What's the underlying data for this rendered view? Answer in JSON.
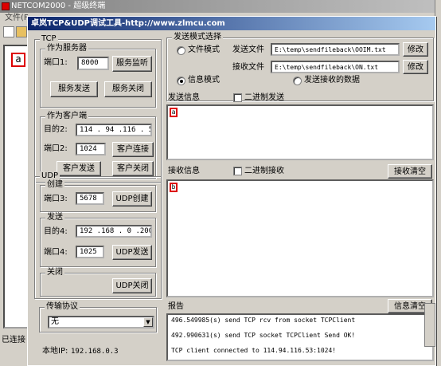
{
  "background_window": {
    "title": "NETCOM2000 - 超级终端",
    "menu_file": "文件(F",
    "edit_mark": "a",
    "status": "已连接"
  },
  "dialog": {
    "title": "卓岚TCP&UDP调试工具-http://www.zlmcu.com"
  },
  "tcp": {
    "group_label": "TCP",
    "server": {
      "group_label": "作为服务器",
      "port_label": "端口1:",
      "port_value": "8000",
      "listen_button": "服务监听",
      "send_button": "服务发送",
      "close_button": "服务关闭"
    },
    "client": {
      "group_label": "作为客户端",
      "target_label": "目的2:",
      "target_value": "114 . 94 .116 . 53",
      "port_label": "端口2:",
      "port_value": "1024",
      "connect_button": "客户连接",
      "send_button": "客户发送",
      "close_button": "客户关闭"
    }
  },
  "udp": {
    "group_label": "UDP",
    "create": {
      "group_label": "创建",
      "port_label": "端口3:",
      "port_value": "5678",
      "create_button": "UDP创建"
    },
    "send": {
      "group_label": "发送",
      "target_label": "目的4:",
      "target_value": "192 .168 . 0 .200",
      "port_label": "端口4:",
      "port_value": "1025",
      "send_button": "UDP发送"
    },
    "close": {
      "group_label": "关闭",
      "close_button": "UDP关闭"
    }
  },
  "protocol": {
    "group_label": "传输协议",
    "selected": "无"
  },
  "local_ip": {
    "label": "本地IP:",
    "value": "192.168.0.3"
  },
  "send_mode": {
    "group_label": "发送模式选择",
    "file_mode_label": "文件模式",
    "info_mode_label": "信息模式",
    "send_file_label": "发送文件",
    "send_file_value": "E:\\temp\\sendfileback\\OOIM.txt",
    "recv_file_label": "接收文件",
    "recv_file_value": "E:\\temp\\sendfileback\\ON.txt",
    "modify_button": "修改",
    "send_received_label": "发送接收的数据"
  },
  "send_info": {
    "label": "发送信息",
    "binary_label": "二进制发送",
    "content": "a"
  },
  "recv_info": {
    "label": "接收信息",
    "binary_label": "二进制接收",
    "clear_button": "接收清空",
    "content": "b"
  },
  "report": {
    "label": "报告",
    "clear_button": "信息清空",
    "lines": [
      "496.549985(s) send TCP rcv from socket TCPClient",
      "492.990631(s) send TCP socket TCPClient Send OK!",
      "TCP client connected to 114.94.116.53:1024!"
    ]
  }
}
